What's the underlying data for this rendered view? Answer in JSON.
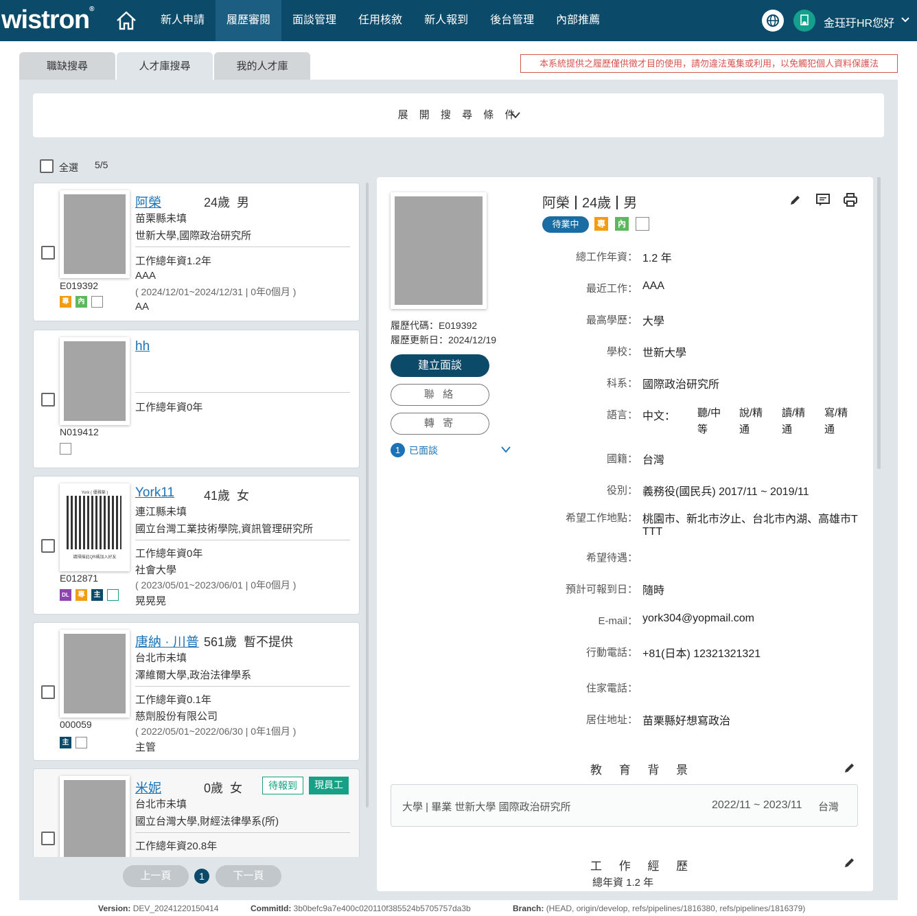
{
  "header": {
    "logo": "wistron",
    "nav": [
      "新人申請",
      "履歷審閱",
      "面談管理",
      "任用核敘",
      "新人報到",
      "後台管理",
      "內部推薦"
    ],
    "greeting": "金珏玗HR您好"
  },
  "tabs": [
    "職缺搜尋",
    "人才庫搜尋",
    "我的人才庫"
  ],
  "notice": "本系統提供之履歷僅供徵才目的使用，請勿違法蒐集或利用，以免觸犯個人資料保護法",
  "search": {
    "expand_label": "展 開 搜 尋 條 件"
  },
  "selection": {
    "select_all": "全選",
    "count": "5/5"
  },
  "candidates": [
    {
      "name": "阿榮",
      "age": "24歲",
      "gender": "男",
      "location": "苗栗縣未填",
      "school": "世新大學,國際政治研究所",
      "years": "工作總年資1.2年",
      "company": "AAA",
      "period": "( 2024/12/01~2024/12/31 | 0年0個月 )",
      "title": "AA",
      "code": "E019392"
    },
    {
      "name": "hh",
      "years": "工作總年資0年",
      "code": "N019412"
    },
    {
      "name": "York11",
      "age": "41歲",
      "gender": "女",
      "location": "連江縣未填",
      "school": "國立台灣工業技術學院,資訊管理研究所",
      "years": "工作總年資0年",
      "company": "社會大學",
      "period": "( 2023/05/01~2023/06/01 | 0年0個月 )",
      "title": "晃晃晃",
      "code": "E012871",
      "qr_title": "York ( 優雅榮 )",
      "qr_caption": "請掃描此QR碼加入好友"
    },
    {
      "name": "唐納 · 川普",
      "age": "561歲",
      "gender": "暫不提供",
      "location": "台北市未填",
      "school": "澤維爾大學,政治法律學系",
      "years": "工作總年資0.1年",
      "company": "慈劑股份有限公司",
      "period": "( 2022/05/01~2022/06/30 | 0年1個月 )",
      "title": "主管",
      "code": "000059"
    },
    {
      "name": "米妮",
      "age": "0歲",
      "gender": "女",
      "location": "台北市未填",
      "school": "國立台灣大學,財經法律學系(所)",
      "years": "工作總年資20.8年",
      "tag1": "待報到",
      "tag2": "現員工"
    }
  ],
  "badge_labels": {
    "pro": "專",
    "internal": "內",
    "main": "主",
    "dl": "DL"
  },
  "pager": {
    "prev": "上一頁",
    "page": "1",
    "next": "下一頁"
  },
  "detail": {
    "resume_code": "履歷代碼：E019392",
    "update_date": "履歷更新日：2024/12/19",
    "btn_interview": "建立面談",
    "btn_contact": "聯 絡",
    "btn_forward": "轉 寄",
    "interviewed_count": "1",
    "interviewed_label": "已面談",
    "name": "阿榮",
    "age": "24歲",
    "gender": "男",
    "status": "待業中",
    "fields": [
      {
        "label": "總工作年資：",
        "value": "1.2 年"
      },
      {
        "label": "最近工作：",
        "value": "AAA"
      },
      {
        "label": "最高學歷：",
        "value": "大學"
      },
      {
        "label": "學校：",
        "value": "世新大學"
      },
      {
        "label": "科系：",
        "value": "國際政治研究所"
      },
      {
        "label": "語言：",
        "value": "中文："
      },
      {
        "label": "國籍：",
        "value": "台灣"
      },
      {
        "label": "役別：",
        "value": "義務役(國民兵) 2017/11 ~ 2019/11"
      },
      {
        "label": "希望工作地點：",
        "value": "桃園市、新北市汐止、台北市內湖、高雄市T"
      },
      {
        "label": "希望待遇：",
        "value": ""
      },
      {
        "label": "預計可報到日：",
        "value": "隨時"
      },
      {
        "label": "E-mail：",
        "value": "york304@yopmail.com"
      },
      {
        "label": "行動電話：",
        "value": "+81(日本) 12321321321"
      },
      {
        "label": "住家電話：",
        "value": ""
      },
      {
        "label": "居住地址：",
        "value": "苗栗縣好想寫政治"
      }
    ],
    "location_cont": "TTT",
    "language_levels": [
      {
        "line1": "聽/中",
        "line2": "等"
      },
      {
        "line1": "說/精",
        "line2": "通"
      },
      {
        "line1": "讀/精",
        "line2": "通"
      },
      {
        "line1": "寫/精",
        "line2": "通"
      }
    ],
    "education_title": "教 育 背 景",
    "education_entry": "大學 | 畢業  世新大學 國際政治研究所",
    "education_period": "2022/11 ~ 2023/11",
    "education_country": "台灣",
    "work_title": "工 作 經 歷",
    "work_total": "總年資 1.2 年"
  },
  "footer": {
    "version_label": "Version:",
    "version": "DEV_20241220150414",
    "commit_label": "CommitId:",
    "commit": "3b0befc9a7e400c020110f385524b5705757da3b",
    "branch_label": "Branch:",
    "branch": "(HEAD, origin/develop, refs/pipelines/1816380, refs/pipelines/1816379)"
  }
}
